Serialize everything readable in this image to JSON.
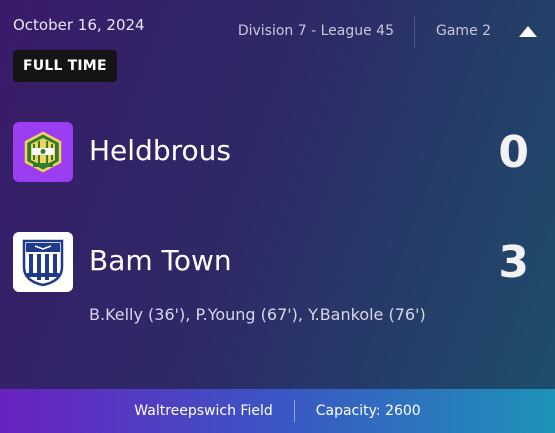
{
  "match": {
    "date": "October 16, 2024",
    "status": "FULL TIME",
    "division": "Division 7 - League 45",
    "game": "Game 2"
  },
  "home": {
    "name": "Heldbrous",
    "score": "0"
  },
  "away": {
    "name": "Bam Town",
    "score": "3",
    "scorers": "B.Kelly (36'), P.Young (67'), Y.Bankole (76')"
  },
  "footer": {
    "venue": "Waltreepswich Field",
    "capacity": "Capacity: 2600"
  },
  "icons": {
    "collapse": "chevron-up-icon",
    "home_crest": "home-team-crest-icon",
    "away_crest": "away-team-crest-icon"
  },
  "colors": {
    "home_crest_bg": "#9b3df0",
    "away_crest_bg": "#ffffff",
    "badge_bg": "#141414"
  }
}
